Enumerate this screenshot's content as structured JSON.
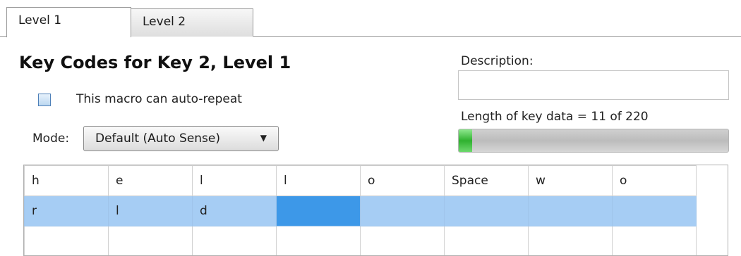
{
  "tabs": [
    {
      "label": "Level 1",
      "active": true
    },
    {
      "label": "Level 2",
      "active": false
    }
  ],
  "heading": "Key Codes for Key 2, Level 1",
  "auto_repeat": {
    "label": "This macro can auto-repeat",
    "checked": false
  },
  "mode": {
    "label": "Mode:",
    "value": "Default (Auto Sense)"
  },
  "description": {
    "label": "Description:",
    "value": ""
  },
  "key_data": {
    "label": "Length of key data = 11 of 220",
    "used": 11,
    "max": 220
  },
  "grid": {
    "rows": [
      [
        "h",
        "e",
        "l",
        "l",
        "o",
        "Space",
        "w",
        "o"
      ],
      [
        "r",
        "l",
        "d",
        "",
        "",
        "",
        "",
        ""
      ],
      [
        "",
        "",
        "",
        "",
        "",
        "",
        "",
        ""
      ]
    ],
    "selected_row": 1,
    "current_cell": 3
  },
  "colors": {
    "selection": "#a6cdf4",
    "current_cell": "#3d98e8",
    "progress": "#2fb12f"
  }
}
